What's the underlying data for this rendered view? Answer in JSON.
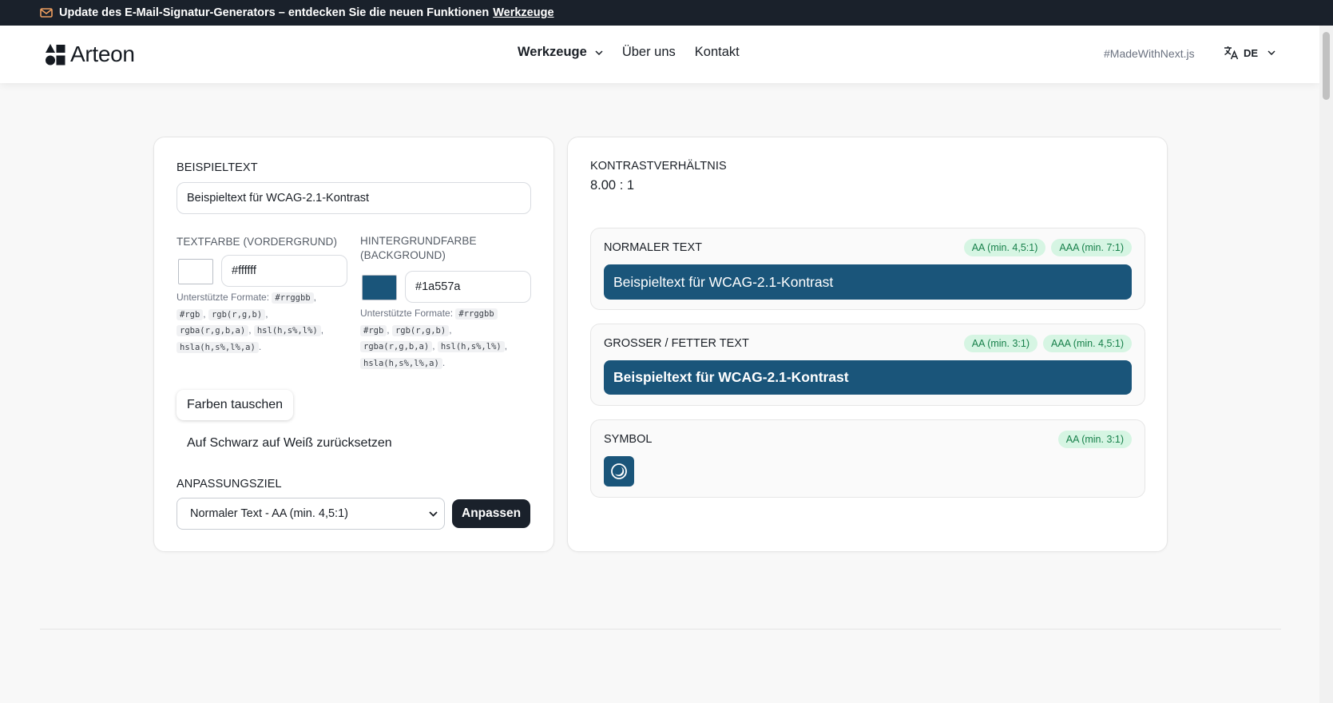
{
  "announcement": {
    "text": "Update des E-Mail-Signatur-Generators – entdecken Sie die neuen Funktionen",
    "link": "Werkzeuge"
  },
  "header": {
    "logo_text": "Arteon",
    "nav": [
      "Werkzeuge",
      "Über uns",
      "Kontakt"
    ],
    "made_with": "#MadeWithNext.js",
    "lang": "DE"
  },
  "form": {
    "sample_label": "BEISPIELTEXT",
    "sample_value": "Beispieltext für WCAG-2.1-Kontrast",
    "fg_label": "TEXTFARBE (VORDERGRUND)",
    "fg_value": "#ffffff",
    "bg_label_1": "HINTERGRUNDFARBE",
    "bg_label_2": "(BACKGROUND)",
    "bg_value": "#1a557a",
    "formats_prefix": "Unterstützte Formate:",
    "formats": [
      "#rrggbb",
      "#rgb",
      "rgb(r,g,b)",
      "rgba(r,g,b,a)",
      "hsl(h,s%,l%)",
      "hsla(h,s%,l%,a)"
    ],
    "swap_button": "Farben tauschen",
    "reset_button": "Auf Schwarz auf Weiß zurücksetzen",
    "target_label": "ANPASSUNGSZIEL",
    "target_selected": "Normaler Text - AA (min. 4,5:1)",
    "adjust_button": "Anpassen"
  },
  "result": {
    "ratio_label": "KONTRASTVERHÄLTNIS",
    "ratio_value": "8.00 : 1",
    "normal": {
      "title": "NORMALER TEXT",
      "badges": [
        "AA (min. 4,5:1)",
        "AAA (min. 7:1)"
      ],
      "sample": "Beispieltext für WCAG-2.1-Kontrast"
    },
    "large": {
      "title": "GROSSER / FETTER TEXT",
      "badges": [
        "AA (min. 3:1)",
        "AAA (min. 4,5:1)"
      ],
      "sample": "Beispieltext für WCAG-2.1-Kontrast"
    },
    "symbol": {
      "title": "SYMBOL",
      "badges": [
        "AA (min. 3:1)"
      ]
    }
  },
  "colors": {
    "foreground": "#ffffff",
    "background": "#1a557a",
    "pass_badge_bg": "#d6f5e3",
    "pass_badge_text": "#17804a"
  },
  "icons": {
    "announcement": "mail-icon",
    "nav_dropdown": "chevron-down-icon",
    "language": "translate-icon",
    "symbol": "moon-circle-icon"
  }
}
